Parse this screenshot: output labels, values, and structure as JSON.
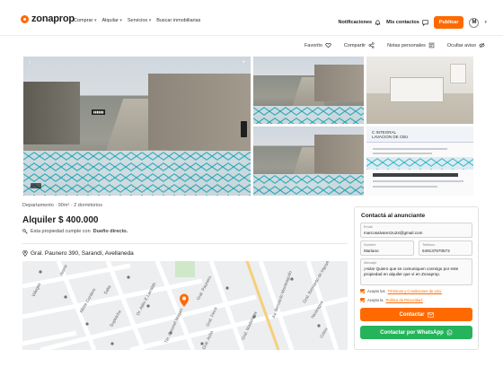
{
  "brand": {
    "name": "zonaprop",
    "accent": "#ff6a00",
    "whatsapp_green": "#25b35b"
  },
  "nav": {
    "items": [
      "Comprar",
      "Alquilar",
      "Servicios",
      "Buscar inmobiliarias"
    ]
  },
  "header_right": {
    "notificaciones": "Notificaciones",
    "mis_contactos": "Mis contactos",
    "publicar": "Publicar",
    "avatar_initial": "M"
  },
  "actions": {
    "favorito": "Favorito",
    "compartir": "Compartir",
    "notas": "Notas personales",
    "ocultar": "Ocultar aviso"
  },
  "gallery": {
    "doc_heading": "C INTEGRAL\nLAVACION DE CBU"
  },
  "listing": {
    "meta": "Departamento · 90m² · 2 dormitorios",
    "price": "Alquiler $ 400.000",
    "owner_note_prefix": "Esta propiedad cumple con",
    "owner_note_bold": "Dueño directo.",
    "address": "Gral. Paunero 390, Sarandí, Avellaneda"
  },
  "map": {
    "streets": [
      "Villegas",
      "Salta",
      "Alsina",
      "Almte Cordero",
      "Supisiche",
      "Dr. Atilio E Larraldo",
      "Gral. Paunero",
      "Cnel. Roca",
      "Ing. Huergo",
      "Juan Madariaga",
      "Gral. Acha",
      "Tte. Coronel Magan",
      "Gral. Ferré",
      "Av. Bernardo Monteagudo",
      "Gral. Bernardo de Irigoyen",
      "Nicaragua",
      "Gral. Madariaga",
      "Gral. Hornos",
      "Jose de Israel",
      "Colon",
      "Gutiérrez",
      "Mitre",
      "Rosetti"
    ]
  },
  "contact_form": {
    "title": "Contactá al anunciante",
    "email_label": "Email",
    "email_value": "marcosalvarezzu24@gmail.com",
    "nombre_label": "Nombre",
    "nombre_value": "Mariano",
    "telefono_label": "Teléfono",
    "telefono_value": "549137670573",
    "mensaje_label": "Mensaje",
    "mensaje_value": "¡Hola! Quiero que se comuniquen conmigo por este propiedad en alquiler que vi en Zonaprop.",
    "terms_prefix": "Acepto los",
    "terms_link": "Términos y Condiciones de Uso.",
    "privacy_prefix": "Acepto la",
    "privacy_link": "Política de Privacidad.",
    "contactar": "Contactar",
    "whatsapp": "Contactar por WhatsApp"
  }
}
